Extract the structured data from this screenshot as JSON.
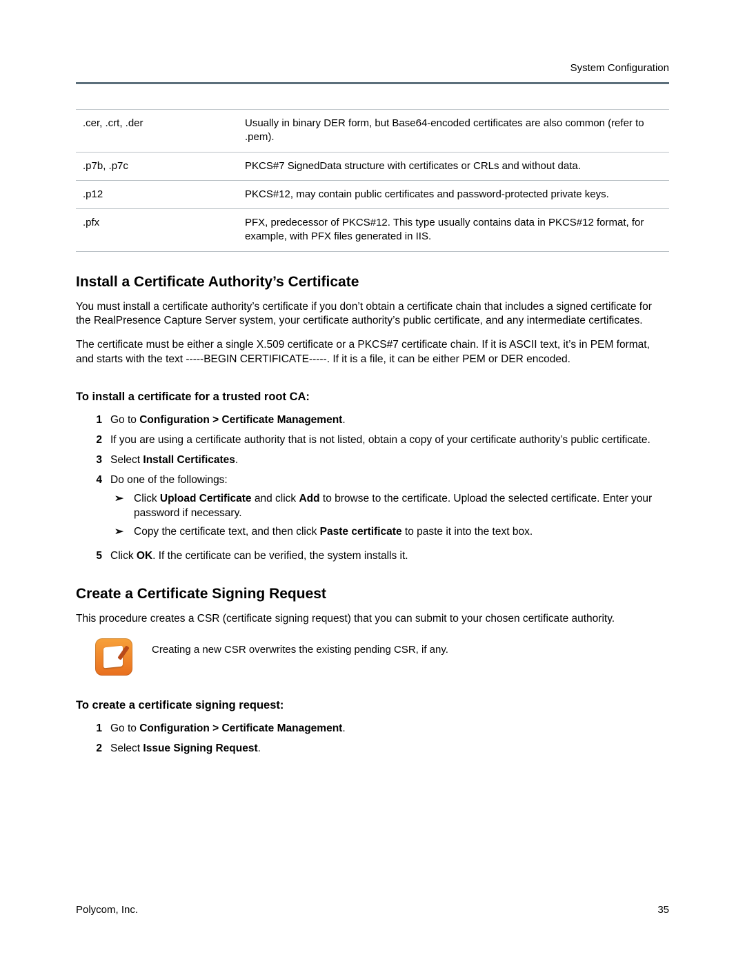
{
  "header": {
    "section": "System Configuration"
  },
  "table": {
    "rows": [
      {
        "ext": ".cer, .crt, .der",
        "desc": "Usually in binary DER form, but Base64-encoded certificates are also common (refer to .pem)."
      },
      {
        "ext": ".p7b, .p7c",
        "desc": "PKCS#7 SignedData structure with certificates or CRLs and without data."
      },
      {
        "ext": ".p12",
        "desc": "PKCS#12, may contain public certificates and password-protected private keys."
      },
      {
        "ext": ".pfx",
        "desc": "PFX, predecessor of PKCS#12. This type usually contains data in PKCS#12 format, for example, with PFX files generated in IIS."
      }
    ]
  },
  "install": {
    "heading": "Install a Certificate Authority’s Certificate",
    "para1": "You must install a certificate authority’s certificate if you don’t obtain a certificate chain that includes a signed certificate for the RealPresence Capture Server system, your certificate authority’s public certificate, and any intermediate certificates.",
    "para2": "The certificate must be either a single X.509 certificate or a PKCS#7 certificate chain. If it is ASCII text, it’s in PEM format, and starts with the text -----BEGIN CERTIFICATE-----. If it is a file, it can be either PEM or DER encoded.",
    "taskHeading": "To install a certificate for a trusted root CA:",
    "step1_pre": "Go to ",
    "step1_bold": "Configuration > Certificate Management",
    "step1_post": ".",
    "step2": "If you are using a certificate authority that is not listed, obtain a copy of your certificate authority’s public certificate.",
    "step3_pre": "Select ",
    "step3_bold": "Install Certificates",
    "step3_post": ".",
    "step4": "Do one of the followings:",
    "step4a_1": "Click ",
    "step4a_b1": "Upload Certificate",
    "step4a_2": " and click ",
    "step4a_b2": "Add",
    "step4a_3": " to browse to the certificate. Upload the selected certificate. Enter your password if necessary.",
    "step4b_1": "Copy the certificate text, and then click ",
    "step4b_b1": "Paste certificate",
    "step4b_2": " to paste it into the text box.",
    "step5_1": "Click ",
    "step5_b1": "OK",
    "step5_2": ". If the certificate can be verified, the system installs it."
  },
  "csr": {
    "heading": "Create a Certificate Signing Request",
    "para1": "This procedure creates a CSR (certificate signing request) that you can submit to your chosen certificate authority.",
    "note": "Creating a new CSR overwrites the existing pending CSR, if any.",
    "taskHeading": "To create a certificate signing request:",
    "step1_pre": "Go to ",
    "step1_bold": "Configuration > Certificate Management",
    "step1_post": ".",
    "step2_pre": "Select ",
    "step2_bold": "Issue Signing Request",
    "step2_post": "."
  },
  "footer": {
    "left": "Polycom, Inc.",
    "right": "35"
  },
  "nums": {
    "n1": "1",
    "n2": "2",
    "n3": "3",
    "n4": "4",
    "n5": "5"
  },
  "glyphs": {
    "arrow": "➢"
  }
}
